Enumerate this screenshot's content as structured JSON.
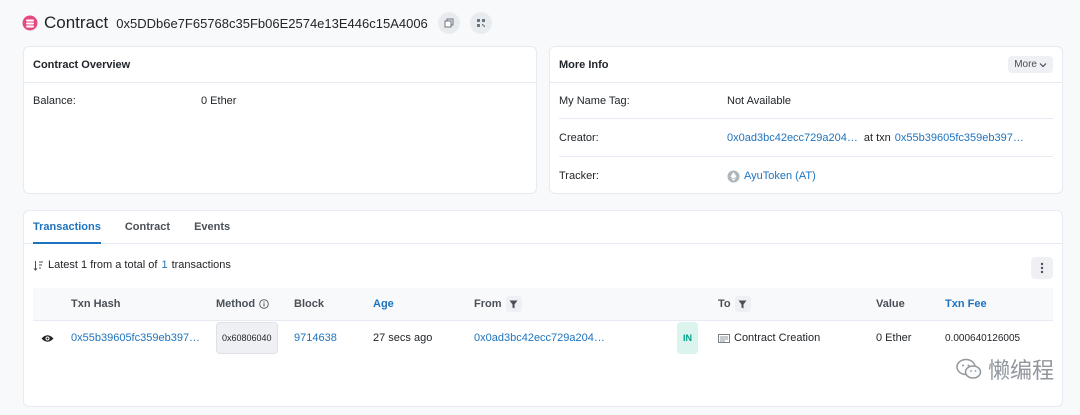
{
  "header": {
    "title": "Contract",
    "address": "0x5DDb6e7F65768c35Fb06E2574e13E446c15A4006"
  },
  "overview": {
    "title": "Contract Overview",
    "balance_label": "Balance:",
    "balance_value": "0 Ether"
  },
  "more_info": {
    "title": "More Info",
    "more_button": "More",
    "name_tag_label": "My Name Tag:",
    "name_tag_value": "Not Available",
    "creator_label": "Creator:",
    "creator_address": "0x0ad3bc42ecc729a204…",
    "creator_at_txn": "at txn",
    "creator_txn": "0x55b39605fc359eb397…",
    "tracker_label": "Tracker:",
    "tracker_value": "AyuToken (AT)"
  },
  "tabs": [
    {
      "label": "Transactions"
    },
    {
      "label": "Contract"
    },
    {
      "label": "Events"
    }
  ],
  "summary": {
    "prefix": "Latest 1 from a total of",
    "count": "1",
    "suffix": "transactions"
  },
  "table": {
    "headers": {
      "txn_hash": "Txn Hash",
      "method": "Method",
      "block": "Block",
      "age": "Age",
      "from": "From",
      "to": "To",
      "value": "Value",
      "txn_fee": "Txn Fee"
    },
    "rows": [
      {
        "txn_hash": "0x55b39605fc359eb397…",
        "method": "0x60806040",
        "block": "9714638",
        "age": "27 secs ago",
        "from": "0x0ad3bc42ecc729a204…",
        "direction": "IN",
        "to": "Contract Creation",
        "value": "0 Ether",
        "txn_fee": "0.000640126005"
      }
    ]
  },
  "watermark": "懒编程",
  "colors": {
    "link": "#1e73be",
    "in_badge_bg": "#dbf4ee",
    "in_badge_text": "#00a186",
    "border": "#e7eaf3"
  }
}
